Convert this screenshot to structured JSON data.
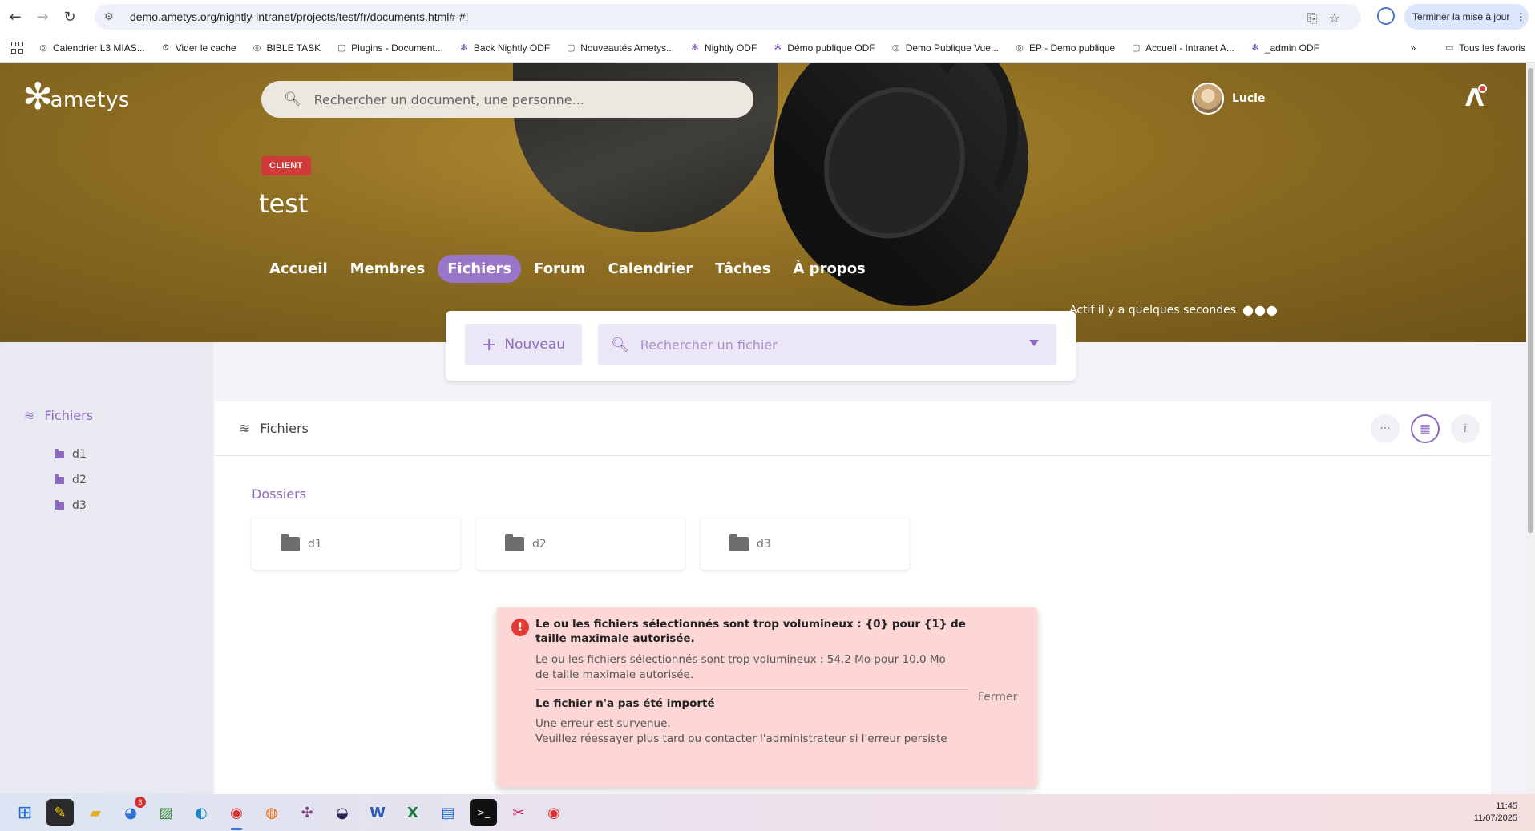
{
  "browser": {
    "url": "demo.ametys.org/nightly-intranet/projects/test/fr/documents.html#-#!",
    "update_label": "Terminer la mise à jour"
  },
  "bookmarks": [
    {
      "label": "Calendrier L3 MIAS...",
      "icon": "globe-icon"
    },
    {
      "label": "Vider le cache",
      "icon": "gear-icon"
    },
    {
      "label": "BIBLE TASK",
      "icon": "globe-icon"
    },
    {
      "label": "Plugins - Document...",
      "icon": "doc-icon"
    },
    {
      "label": "Back Nightly ODF",
      "icon": "ametys-icon"
    },
    {
      "label": "Nouveautés Ametys...",
      "icon": "doc-icon"
    },
    {
      "label": "Nightly ODF",
      "icon": "ametys-icon"
    },
    {
      "label": "Démo publique ODF",
      "icon": "ametys-icon"
    },
    {
      "label": "Demo Publique Vue...",
      "icon": "globe-icon"
    },
    {
      "label": "EP - Demo publique",
      "icon": "globe-icon"
    },
    {
      "label": "Accueil - Intranet A...",
      "icon": "doc-icon"
    },
    {
      "label": "_admin ODF",
      "icon": "ametys-icon"
    }
  ],
  "bookmarks_all": "Tous les favoris",
  "app": {
    "logo_text": "ametys",
    "search_placeholder": "Rechercher un document, une personne...",
    "user_name": "Lucie",
    "badge": "CLIENT",
    "project_title": "test",
    "tabs": [
      {
        "label": "Accueil",
        "active": false
      },
      {
        "label": "Membres",
        "active": false
      },
      {
        "label": "Fichiers",
        "active": true
      },
      {
        "label": "Forum",
        "active": false
      },
      {
        "label": "Calendrier",
        "active": false
      },
      {
        "label": "Tâches",
        "active": false
      },
      {
        "label": "À propos",
        "active": false
      }
    ],
    "activity": "Actif il y a quelques secondes",
    "accent_color": "#9a76c9"
  },
  "toolbar": {
    "new_label": "Nouveau",
    "search_placeholder": "Rechercher un fichier"
  },
  "sidebar": {
    "title": "Fichiers",
    "items": [
      "d1",
      "d2",
      "d3"
    ]
  },
  "content": {
    "title": "Fichiers",
    "section_label": "Dossiers",
    "folders": [
      "d1",
      "d2",
      "d3"
    ]
  },
  "error": {
    "title": "Le ou les fichiers sélectionnés sont trop volumineux : {0} pour {1} de taille maximale autorisée.",
    "detail": "Le ou les fichiers sélectionnés sont trop volumineux : 54.2 Mo pour 10.0 Mo de taille maximale autorisée.",
    "title2": "Le fichier n'a pas été importé",
    "detail2_line1": "Une erreur est survenue.",
    "detail2_line2": "Veuillez réessayer plus tard ou contacter l'administrateur si l'erreur persiste",
    "close_label": "Fermer"
  },
  "taskbar": {
    "time": "11:45",
    "date": "11/07/2025",
    "badge_count": "3"
  }
}
